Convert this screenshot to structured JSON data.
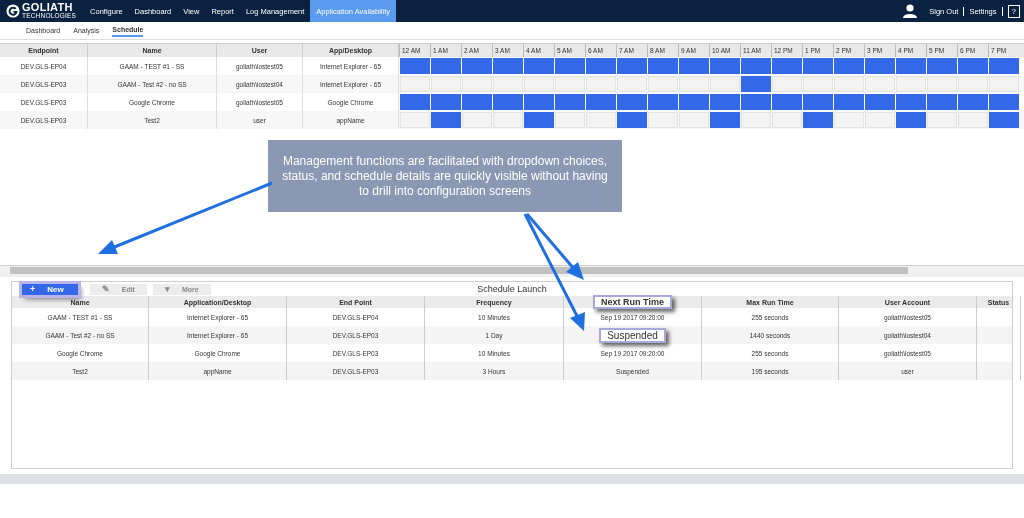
{
  "nav": {
    "logo": {
      "name": "GOLIATH",
      "subtitle": "TECHNOLOGIES"
    },
    "items": [
      {
        "label": "Configure",
        "selected": false
      },
      {
        "label": "Dashboard",
        "selected": false
      },
      {
        "label": "View",
        "selected": false
      },
      {
        "label": "Report",
        "selected": false
      },
      {
        "label": "Log Management",
        "selected": false
      },
      {
        "label": "Application Availability",
        "selected": true
      }
    ],
    "sign_out": "Sign Out",
    "settings": "Settings",
    "help": "?"
  },
  "subtabs": [
    {
      "label": "Dashboard",
      "selected": false
    },
    {
      "label": "Analysis",
      "selected": false
    },
    {
      "label": "Schedule",
      "selected": true
    }
  ],
  "timeline": {
    "columns": [
      "Endpoint",
      "Name",
      "User",
      "App/Desktop"
    ],
    "hours": [
      "12 AM",
      "1 AM",
      "2 AM",
      "3 AM",
      "4 AM",
      "5 AM",
      "6 AM",
      "7 AM",
      "8 AM",
      "9 AM",
      "10 AM",
      "11 AM",
      "12 PM",
      "1 PM",
      "2 PM",
      "3 PM",
      "4 PM",
      "5 PM",
      "6 PM",
      "7 PM"
    ],
    "rows": [
      {
        "cells": [
          "DEV.GLS-EP04",
          "GAAM - TEST #1 - SS",
          "goliath\\lostest05",
          "Internet Explorer - 65"
        ],
        "slots": [
          true,
          true,
          true,
          true,
          true,
          true,
          true,
          true,
          true,
          true,
          true,
          true,
          true,
          true,
          true,
          true,
          true,
          true,
          true,
          true
        ]
      },
      {
        "cells": [
          "DEV.GLS-EP03",
          "GAAM - Test #2 - no SS",
          "goliath\\lostest04",
          "Internet Explorer - 65"
        ],
        "slots": [
          false,
          false,
          false,
          false,
          false,
          false,
          false,
          false,
          false,
          false,
          false,
          true,
          false,
          false,
          false,
          false,
          false,
          false,
          false,
          false
        ]
      },
      {
        "cells": [
          "DEV.GLS-EP03",
          "Google Chrome",
          "goliath\\lostest05",
          "Google Chrome"
        ],
        "slots": [
          true,
          true,
          true,
          true,
          true,
          true,
          true,
          true,
          true,
          true,
          true,
          true,
          true,
          true,
          true,
          true,
          true,
          true,
          true,
          true
        ]
      },
      {
        "cells": [
          "DEV.GLS-EP03",
          "Test2",
          "user",
          "appName"
        ],
        "slots": [
          false,
          true,
          false,
          false,
          true,
          false,
          false,
          true,
          false,
          false,
          true,
          false,
          false,
          true,
          false,
          false,
          true,
          false,
          false,
          true
        ]
      }
    ]
  },
  "callout": "Management functions are facilitated with dropdown choices, status, and schedule details are quickly visible without having to drill into configuration screens",
  "schedule": {
    "title": "Schedule Launch",
    "buttons": [
      {
        "label": "New",
        "icon": "+",
        "disabled": false,
        "highlighted": true
      },
      {
        "label": "Edit",
        "icon": "✎",
        "disabled": true,
        "highlighted": false
      },
      {
        "label": "More",
        "icon": "▾",
        "disabled": true,
        "highlighted": false
      }
    ],
    "columns": [
      {
        "label": "Name",
        "highlighted": false
      },
      {
        "label": "Application/Desktop",
        "highlighted": false
      },
      {
        "label": "End Point",
        "highlighted": false
      },
      {
        "label": "Frequency",
        "highlighted": false
      },
      {
        "label": "Next Run Time",
        "highlighted": true
      },
      {
        "label": "Max Run Time",
        "highlighted": false
      },
      {
        "label": "User Account",
        "highlighted": false
      },
      {
        "label": "Status",
        "highlighted": false
      }
    ],
    "rows": [
      {
        "cells": [
          "GAAM - TEST #1 - SS",
          "Internet Explorer - 65",
          "DEV.GLS-EP04",
          "10 Minutes",
          "Sep 19 2017 09:20:00",
          "255 seconds",
          "goliath\\lostest05"
        ],
        "highlight_cell": false
      },
      {
        "cells": [
          "GAAM - Test #2 - no SS",
          "Internet Explorer - 65",
          "DEV.GLS-EP03",
          "1 Day",
          "Suspended",
          "1440 seconds",
          "goliath\\lostest04"
        ],
        "highlight_cell": true
      },
      {
        "cells": [
          "Google Chrome",
          "Google Chrome",
          "DEV.GLS-EP03",
          "10 Minutes",
          "Sep 19 2017 09:20:00",
          "255 seconds",
          "goliath\\lostest05"
        ],
        "highlight_cell": false
      },
      {
        "cells": [
          "Test2",
          "appName",
          "DEV.GLS-EP03",
          "3 Hours",
          "Suspended",
          "195 seconds",
          "user"
        ],
        "highlight_cell": false
      }
    ]
  }
}
